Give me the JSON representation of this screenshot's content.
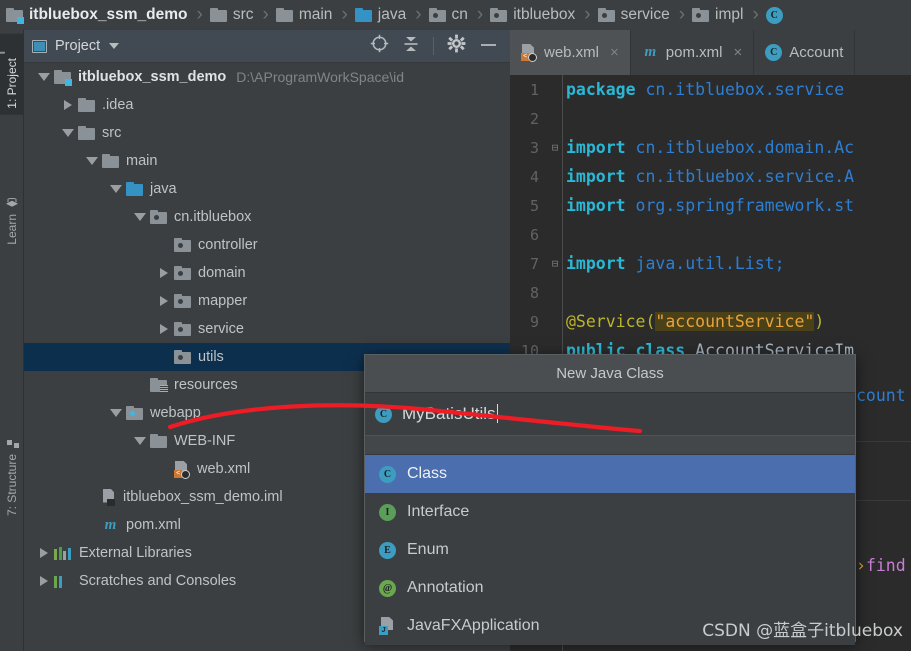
{
  "breadcrumb": {
    "separator": "›",
    "items": [
      {
        "label": "itbluebox_ssm_demo",
        "icon": "folder-module-icon",
        "root": true
      },
      {
        "label": "src",
        "icon": "folder-icon"
      },
      {
        "label": "main",
        "icon": "folder-icon"
      },
      {
        "label": "java",
        "icon": "folder-source-icon"
      },
      {
        "label": "cn",
        "icon": "folder-package-icon"
      },
      {
        "label": "itbluebox",
        "icon": "folder-package-icon"
      },
      {
        "label": "service",
        "icon": "folder-package-icon"
      },
      {
        "label": "impl",
        "icon": "folder-package-icon"
      },
      {
        "label": "",
        "icon": "class-icon"
      }
    ]
  },
  "rail": {
    "buttons": [
      {
        "label": "1: Project",
        "icon": "project-folder-icon",
        "active": true
      },
      {
        "label": "Learn",
        "icon": "graduation-cap-icon",
        "active": false
      },
      {
        "label": "7: Structure",
        "icon": "structure-icon",
        "active": false
      }
    ]
  },
  "panel": {
    "title": "Project",
    "window_icon": "project-window-icon",
    "dropdown_icon": "chevron-down-icon",
    "tools": [
      {
        "name": "locate-icon"
      },
      {
        "name": "collapse-all-icon"
      },
      {
        "name": "settings-gear-icon"
      },
      {
        "name": "minimize-icon"
      }
    ]
  },
  "tree": {
    "rows": [
      {
        "label": "itbluebox_ssm_demo",
        "path": "D:\\AProgramWorkSpace\\id",
        "indent": 0,
        "state": "open",
        "icon": "folder-module-icon",
        "bold": true,
        "selected": false
      },
      {
        "label": ".idea",
        "path": "",
        "indent": 1,
        "state": "closed",
        "icon": "folder-icon",
        "bold": false,
        "selected": false
      },
      {
        "label": "src",
        "path": "",
        "indent": 1,
        "state": "open",
        "icon": "folder-icon",
        "bold": false,
        "selected": false
      },
      {
        "label": "main",
        "path": "",
        "indent": 2,
        "state": "open",
        "icon": "folder-icon",
        "bold": false,
        "selected": false
      },
      {
        "label": "java",
        "path": "",
        "indent": 3,
        "state": "open",
        "icon": "folder-source-icon",
        "bold": false,
        "selected": false
      },
      {
        "label": "cn.itbluebox",
        "path": "",
        "indent": 4,
        "state": "open",
        "icon": "folder-package-icon",
        "bold": false,
        "selected": false
      },
      {
        "label": "controller",
        "path": "",
        "indent": 5,
        "state": "leaf",
        "icon": "folder-package-icon",
        "bold": false,
        "selected": false
      },
      {
        "label": "domain",
        "path": "",
        "indent": 5,
        "state": "closed",
        "icon": "folder-package-icon",
        "bold": false,
        "selected": false
      },
      {
        "label": "mapper",
        "path": "",
        "indent": 5,
        "state": "closed",
        "icon": "folder-package-icon",
        "bold": false,
        "selected": false
      },
      {
        "label": "service",
        "path": "",
        "indent": 5,
        "state": "closed",
        "icon": "folder-package-icon",
        "bold": false,
        "selected": false
      },
      {
        "label": "utils",
        "path": "",
        "indent": 5,
        "state": "leaf",
        "icon": "folder-package-icon",
        "bold": false,
        "selected": true
      },
      {
        "label": "resources",
        "path": "",
        "indent": 4,
        "state": "leaf",
        "icon": "folder-resources-icon",
        "bold": false,
        "selected": false
      },
      {
        "label": "webapp",
        "path": "",
        "indent": 3,
        "state": "open",
        "icon": "folder-webapp-icon",
        "bold": false,
        "selected": false
      },
      {
        "label": "WEB-INF",
        "path": "",
        "indent": 4,
        "state": "open",
        "icon": "folder-icon",
        "bold": false,
        "selected": false
      },
      {
        "label": "web.xml",
        "path": "",
        "indent": 5,
        "state": "leaf",
        "icon": "xml-file-icon",
        "bold": false,
        "selected": false
      },
      {
        "label": "itbluebox_ssm_demo.iml",
        "path": "",
        "indent": 2,
        "state": "leaf",
        "icon": "iml-file-icon",
        "bold": false,
        "selected": false
      },
      {
        "label": "pom.xml",
        "path": "",
        "indent": 2,
        "state": "leaf",
        "icon": "maven-file-icon",
        "bold": false,
        "selected": false
      },
      {
        "label": "External Libraries",
        "path": "",
        "indent": 0,
        "state": "closed",
        "icon": "libraries-icon",
        "bold": false,
        "selected": false
      },
      {
        "label": "Scratches and Consoles",
        "path": "",
        "indent": 0,
        "state": "closed",
        "icon": "scratches-icon",
        "bold": false,
        "selected": false
      }
    ]
  },
  "editor": {
    "tabs": [
      {
        "label": "web.xml",
        "icon": "xml-file-icon",
        "active": true,
        "close": "×"
      },
      {
        "label": "pom.xml",
        "icon": "maven-file-icon",
        "active": false,
        "close": "×"
      },
      {
        "label": "Account",
        "icon": "class-icon",
        "active": false,
        "close": ""
      }
    ],
    "lines": [
      {
        "num": "1",
        "fold": "",
        "segments": [
          {
            "t": "package ",
            "c": "kw"
          },
          {
            "t": "cn.itbluebox.service",
            "c": "ref"
          }
        ]
      },
      {
        "num": "2",
        "fold": "",
        "segments": []
      },
      {
        "num": "3",
        "fold": "⊟",
        "segments": [
          {
            "t": "import ",
            "c": "kw"
          },
          {
            "t": "cn.itbluebox.domain.Ac",
            "c": "ref"
          }
        ]
      },
      {
        "num": "4",
        "fold": "",
        "segments": [
          {
            "t": "import ",
            "c": "kw"
          },
          {
            "t": "cn.itbluebox.service.A",
            "c": "ref"
          }
        ]
      },
      {
        "num": "5",
        "fold": "",
        "segments": [
          {
            "t": "import ",
            "c": "kw"
          },
          {
            "t": "org.springframework.st",
            "c": "ref"
          }
        ]
      },
      {
        "num": "6",
        "fold": "",
        "segments": []
      },
      {
        "num": "7",
        "fold": "⊟",
        "segments": [
          {
            "t": "import ",
            "c": "kw"
          },
          {
            "t": "java.util.List;",
            "c": "ref"
          }
        ]
      },
      {
        "num": "8",
        "fold": "",
        "segments": []
      },
      {
        "num": "9",
        "fold": "",
        "segments": [
          {
            "t": "@Service(",
            "c": "ann"
          },
          {
            "t": "\"accountService\"",
            "c": "str"
          },
          {
            "t": ")",
            "c": "ann"
          }
        ]
      },
      {
        "num": "10",
        "fold": "",
        "segments": [
          {
            "t": "public class ",
            "c": "kw"
          },
          {
            "t": "AccountServiceIm",
            "c": "plain"
          }
        ]
      }
    ],
    "overflow_line": {
      "text": "count",
      "color_class": "ref"
    },
    "method_line": {
      "chevron": "›",
      "text": "find",
      "color_class": "meth"
    }
  },
  "dialog": {
    "title": "New Java Class",
    "input_value": "MyBatisUtils",
    "input_icon": "class-icon",
    "items": [
      {
        "label": "Class",
        "icon": "class-icon",
        "letter": "C",
        "kind": "c",
        "selected": true
      },
      {
        "label": "Interface",
        "icon": "interface-icon",
        "letter": "I",
        "kind": "i",
        "selected": false
      },
      {
        "label": "Enum",
        "icon": "enum-icon",
        "letter": "E",
        "kind": "e",
        "selected": false
      },
      {
        "label": "Annotation",
        "icon": "annotation-icon",
        "letter": "@",
        "kind": "a",
        "selected": false
      },
      {
        "label": "JavaFXApplication",
        "icon": "javafx-icon",
        "letter": "J",
        "kind": "fx",
        "selected": false
      }
    ]
  },
  "annotation": {
    "name": "red-highlight-curve",
    "color": "#ee1c25"
  },
  "watermark": {
    "text": "CSDN @蓝盒子itbluebox"
  },
  "colors": {
    "panel_bg": "#3c3f41",
    "editor_bg": "#2b2b2b",
    "selection_tree": "#0d2f4e",
    "selection_list": "#4b6eaf",
    "accent_blue": "#3592c4"
  }
}
